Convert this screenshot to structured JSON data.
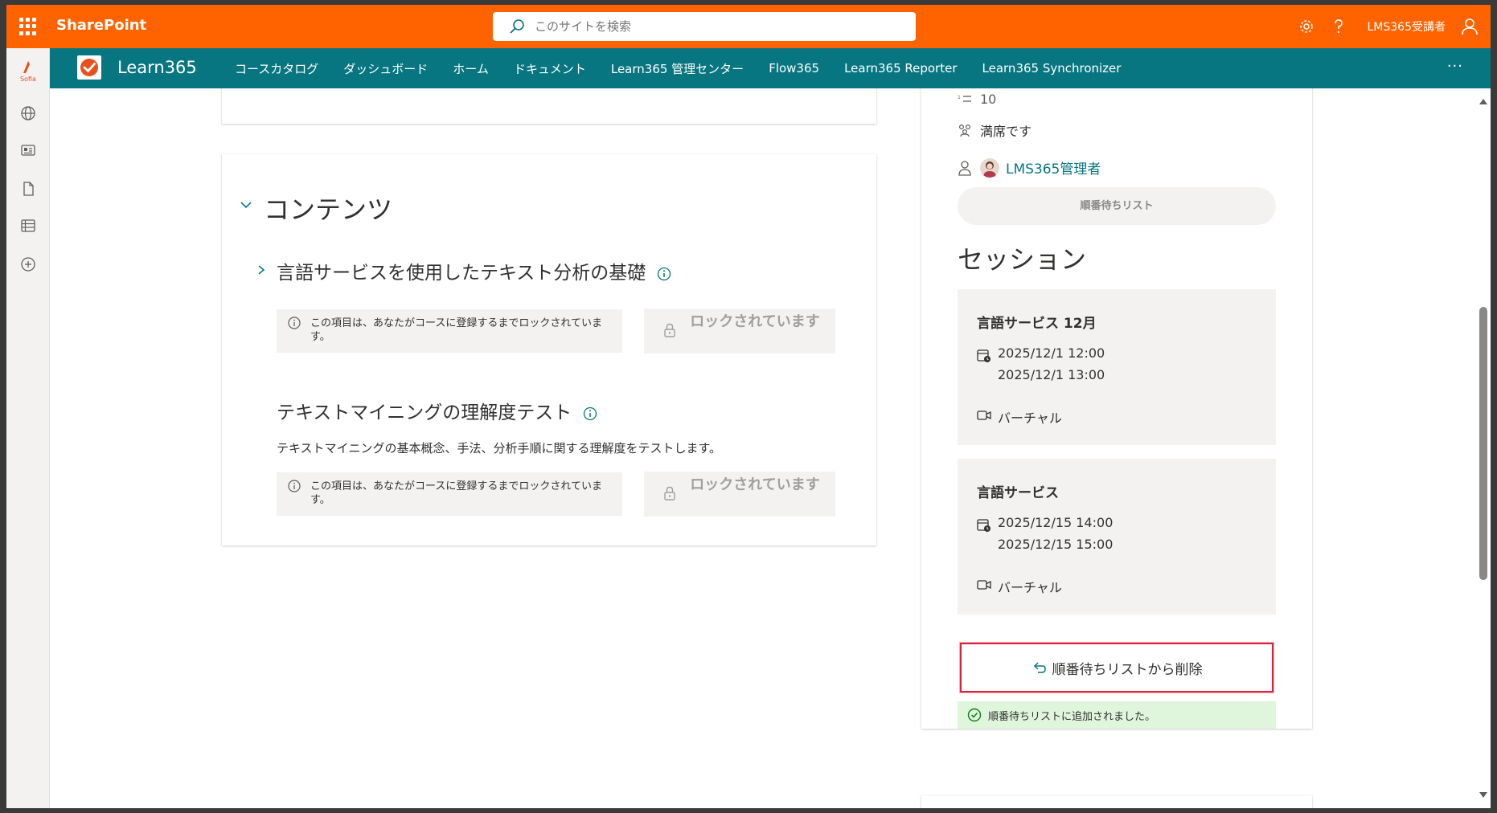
{
  "suitebar": {
    "app_name": "SharePoint",
    "search_placeholder": "このサイトを検索",
    "user_name": "LMS365受講者"
  },
  "rail": {
    "logo_text": "Sofia"
  },
  "hubnav": {
    "site_title": "Learn365",
    "items": [
      {
        "label": "コースカタログ"
      },
      {
        "label": "ダッシュボード"
      },
      {
        "label": "ホーム"
      },
      {
        "label": "ドキュメント"
      },
      {
        "label": "Learn365 管理センター"
      },
      {
        "label": "Flow365"
      },
      {
        "label": "Learn365 Reporter"
      },
      {
        "label": "Learn365 Synchronizer"
      }
    ],
    "more": "···"
  },
  "content": {
    "section_title": "コンテンツ",
    "items": [
      {
        "title": "言語サービスを使用したテキスト分析の基礎",
        "lock_message": "この項目は、あなたがコースに登録するまでロックされています。",
        "lock_button": "ロックされています"
      },
      {
        "title": "テキストマイニングの理解度テスト",
        "description": "テキストマイニングの基本概念、手法、分析手順に関する理解度をテストします。",
        "lock_message": "この項目は、あなたがコースに登録するまでロックされています。",
        "lock_button": "ロックされています"
      }
    ]
  },
  "sidepanel": {
    "capacity": "10",
    "status": "満席です",
    "instructor": "LMS365管理者",
    "waitlist_button": "順番待ちリスト",
    "sessions_title": "セッション",
    "sessions": [
      {
        "title": "言語サービス 12月",
        "start": "2025/12/1 12:00",
        "end": "2025/12/1 13:00",
        "location": "バーチャル"
      },
      {
        "title": "言語サービス",
        "start": "2025/12/15 14:00",
        "end": "2025/12/15 15:00",
        "location": "バーチャル"
      }
    ],
    "remove_button": "順番待ちリストから削除",
    "success_message": "順番待ちリストに追加されました。"
  },
  "colors": {
    "suitebar": "#ff6300",
    "hubnav": "#077681",
    "link": "#077681",
    "highlight_border": "#e01f3d",
    "success_bg": "#dff6dd"
  }
}
